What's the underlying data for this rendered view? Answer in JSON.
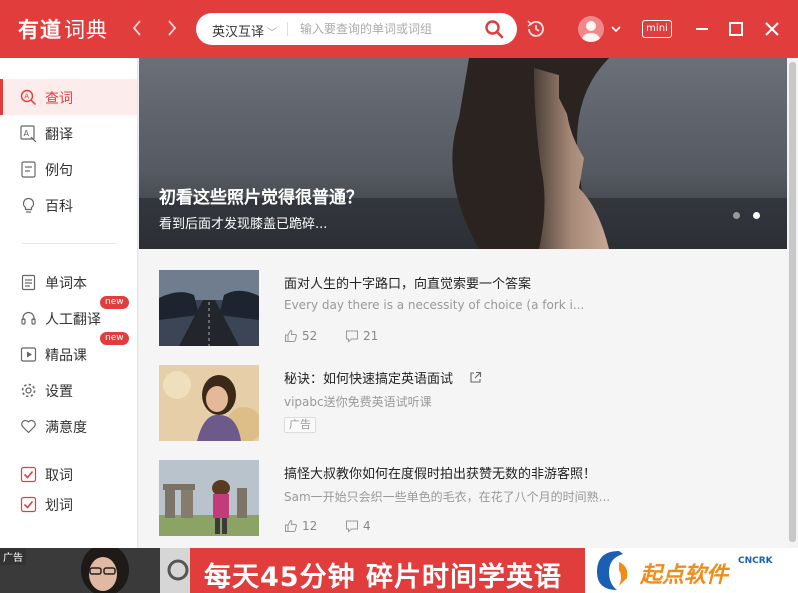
{
  "app": {
    "logo_brand": "有道",
    "logo_product": "词典"
  },
  "search": {
    "mode": "英汉互译",
    "placeholder": "输入要查询的单词或词组",
    "value": ""
  },
  "titlebar": {
    "mini_label": "mini"
  },
  "sidebar": {
    "items": [
      {
        "label": "查词",
        "icon": "search-icon",
        "active": true
      },
      {
        "label": "翻译",
        "icon": "translate-icon"
      },
      {
        "label": "例句",
        "icon": "document-icon"
      },
      {
        "label": "百科",
        "icon": "lightbulb-icon"
      },
      {
        "label": "单词本",
        "icon": "notebook-icon"
      },
      {
        "label": "人工翻译",
        "icon": "headset-icon",
        "badge": "new"
      },
      {
        "label": "精品课",
        "icon": "play-icon",
        "badge": "new"
      },
      {
        "label": "设置",
        "icon": "gear-icon"
      },
      {
        "label": "满意度",
        "icon": "heart-icon"
      },
      {
        "label": "取词",
        "icon": "checkbox-icon",
        "checked": true
      },
      {
        "label": "划词",
        "icon": "checkbox-icon",
        "checked": true
      }
    ]
  },
  "hero": {
    "title": "初看这些照片觉得很普通？",
    "subtitle": "看到后面才发现膝盖已跪碎...",
    "slide_count": 2,
    "active_slide": 2
  },
  "feed": [
    {
      "title": "面对人生的十字路口，向直觉索要一个答案",
      "subtitle": "Every day there is a necessity of choice (a fork i...",
      "likes": "52",
      "comments": "21"
    },
    {
      "title": "秘诀：如何快速搞定英语面试",
      "subtitle": "vipabc送你免费英语试听课",
      "tag": "广告"
    },
    {
      "title": "搞怪大叔教你如何在度假时拍出获赞无数的非游客照！",
      "subtitle": "Sam一开始只会织一些单色的毛衣，在花了八个月的时间熟...",
      "likes": "12",
      "comments": "4"
    }
  ],
  "banner": {
    "ad_label": "广告",
    "text": "每天45分钟  碎片时间学英语",
    "watermark": "起点软件",
    "watermark_sub": "CNCRK"
  },
  "colors": {
    "brand": "#e23d3d",
    "active_bg": "#fdecec"
  }
}
